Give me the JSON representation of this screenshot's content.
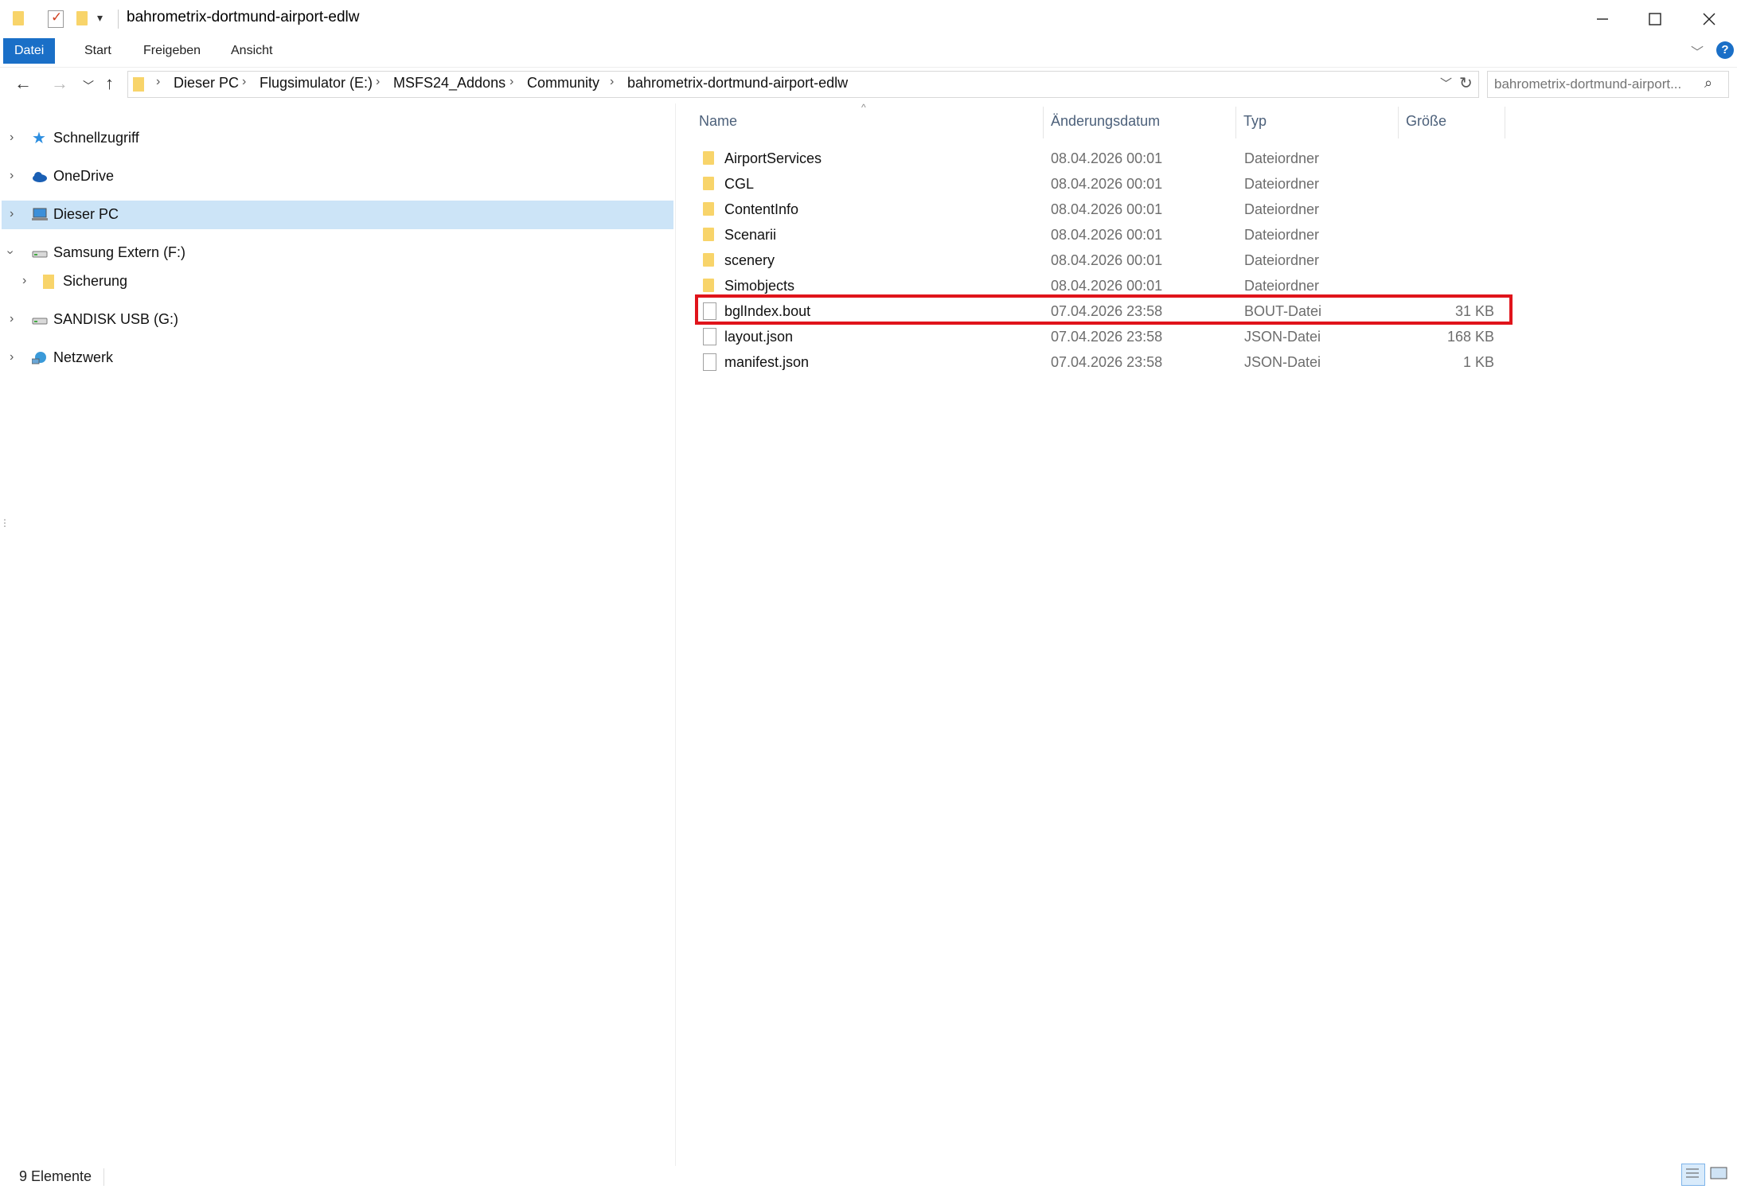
{
  "window": {
    "title": "bahrometrix-dortmund-airport-edlw"
  },
  "ribbon": {
    "tabs": [
      {
        "label": "Datei",
        "active": true
      },
      {
        "label": "Start"
      },
      {
        "label": "Freigeben"
      },
      {
        "label": "Ansicht"
      }
    ]
  },
  "address": {
    "breadcrumbs": [
      "Dieser PC",
      "Flugsimulator (E:)",
      "MSFS24_Addons",
      "Community",
      "bahrometrix-dortmund-airport-edlw"
    ],
    "search_placeholder": "bahrometrix-dortmund-airport..."
  },
  "nav": {
    "items": [
      {
        "label": "Schnellzugriff",
        "icon": "star-icon"
      },
      {
        "label": "OneDrive",
        "icon": "cloud-icon"
      },
      {
        "label": "Dieser PC",
        "icon": "computer-icon",
        "selected": true
      },
      {
        "label": "Samsung Extern (F:)",
        "icon": "drive-icon",
        "expanded": true
      },
      {
        "label": "Sicherung",
        "icon": "folder-icon"
      },
      {
        "label": "SANDISK USB (G:)",
        "icon": "drive-icon"
      },
      {
        "label": "Netzwerk",
        "icon": "network-icon"
      }
    ]
  },
  "list": {
    "columns": [
      "Name",
      "Änderungsdatum",
      "Typ",
      "Größe"
    ],
    "rows": [
      {
        "name": "AirportServices",
        "date": "08.04.2026 00:01",
        "type": "Dateiordner",
        "size": "",
        "icon": "folder-icon"
      },
      {
        "name": "CGL",
        "date": "08.04.2026 00:01",
        "type": "Dateiordner",
        "size": "",
        "icon": "folder-icon"
      },
      {
        "name": "ContentInfo",
        "date": "08.04.2026 00:01",
        "type": "Dateiordner",
        "size": "",
        "icon": "folder-icon"
      },
      {
        "name": "Scenarii",
        "date": "08.04.2026 00:01",
        "type": "Dateiordner",
        "size": "",
        "icon": "folder-icon"
      },
      {
        "name": "scenery",
        "date": "08.04.2026 00:01",
        "type": "Dateiordner",
        "size": "",
        "icon": "folder-icon"
      },
      {
        "name": "Simobjects",
        "date": "08.04.2026 00:01",
        "type": "Dateiordner",
        "size": "",
        "icon": "folder-icon"
      },
      {
        "name": "bglIndex.bout",
        "date": "07.04.2026 23:58",
        "type": "BOUT-Datei",
        "size": "31 KB",
        "icon": "file-icon",
        "highlighted": true
      },
      {
        "name": "layout.json",
        "date": "07.04.2026 23:58",
        "type": "JSON-Datei",
        "size": "168 KB",
        "icon": "file-icon"
      },
      {
        "name": "manifest.json",
        "date": "07.04.2026 23:58",
        "type": "JSON-Datei",
        "size": "1 KB",
        "icon": "file-icon"
      }
    ]
  },
  "status": {
    "count": "9 Elemente"
  },
  "colors": {
    "accent": "#1a6fc7",
    "selection": "#cce4f7",
    "highlight": "#e0141b",
    "folder": "#f8d46a"
  }
}
